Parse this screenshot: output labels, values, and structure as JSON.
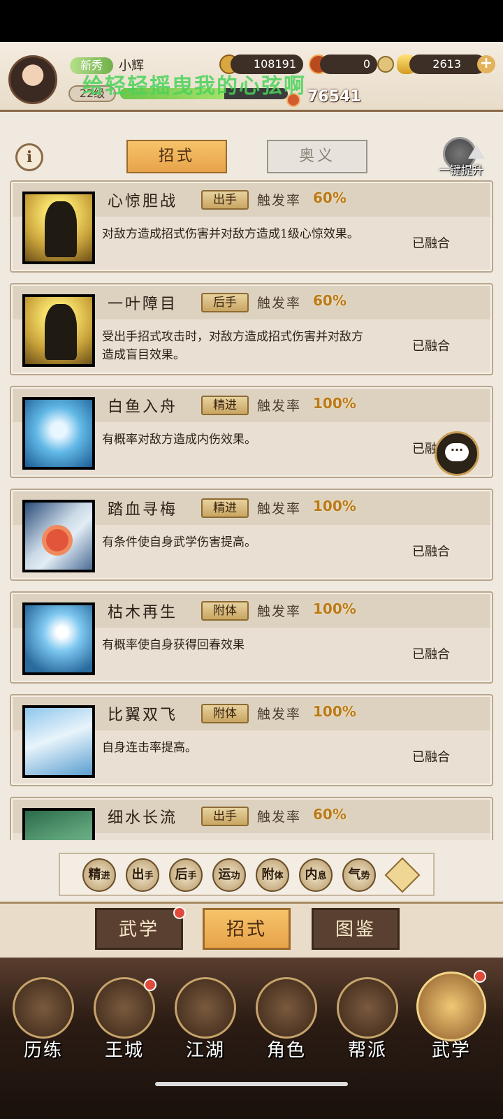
{
  "player": {
    "rank": "新秀",
    "name": "小辉",
    "level": "22级",
    "overlay_text": "给轻轻摇曳我的心弦啊",
    "power": "76541",
    "copper": "108191",
    "flame": "0",
    "gold": "2613",
    "plus": "+"
  },
  "tabs": {
    "info": "i",
    "active": "招式",
    "inactive": "奥义",
    "upgrade_all": "一键提升"
  },
  "skills": [
    {
      "name": "心惊胆战",
      "type": "出手",
      "rate_label": "触发率",
      "rate": "60%",
      "desc": "对敌方造成招式伤害并对敌方造成1级心惊效果。",
      "status": "已融合"
    },
    {
      "name": "一叶障目",
      "type": "后手",
      "rate_label": "触发率",
      "rate": "60%",
      "desc": "受出手招式攻击时，对敌方造成招式伤害并对敌方造成盲目效果。",
      "status": "已融合"
    },
    {
      "name": "白鱼入舟",
      "type": "精进",
      "rate_label": "触发率",
      "rate": "100%",
      "desc": "有概率对敌方造成内伤效果。",
      "status": "已融"
    },
    {
      "name": "踏血寻梅",
      "type": "精进",
      "rate_label": "触发率",
      "rate": "100%",
      "desc": "有条件使自身武学伤害提高。",
      "status": "已融合"
    },
    {
      "name": "枯木再生",
      "type": "附体",
      "rate_label": "触发率",
      "rate": "100%",
      "desc": "有概率使自身获得回春效果",
      "status": "已融合"
    },
    {
      "name": "比翼双飞",
      "type": "附体",
      "rate_label": "触发率",
      "rate": "100%",
      "desc": "自身连击率提高。",
      "status": "已融合"
    },
    {
      "name": "细水长流",
      "type": "出手",
      "rate_label": "触发率",
      "rate": "60%",
      "desc": "",
      "status": ""
    }
  ],
  "chat": "···",
  "filters": [
    {
      "main": "精",
      "sub": "进"
    },
    {
      "main": "出",
      "sub": "手"
    },
    {
      "main": "后",
      "sub": "手"
    },
    {
      "main": "运",
      "sub": "功"
    },
    {
      "main": "附",
      "sub": "体"
    },
    {
      "main": "内",
      "sub": "息"
    },
    {
      "main": "气",
      "sub": "势"
    }
  ],
  "sub_tabs": [
    "武学",
    "招式",
    "图鉴"
  ],
  "bottom_nav": [
    "历练",
    "王城",
    "江湖",
    "角色",
    "帮派",
    "武学"
  ],
  "colors": {
    "accent_gold": "#e7a34a",
    "rate_gold": "#ba7a1a",
    "exp_green": "#6cc64a",
    "dark_brown": "#2b1c14"
  }
}
